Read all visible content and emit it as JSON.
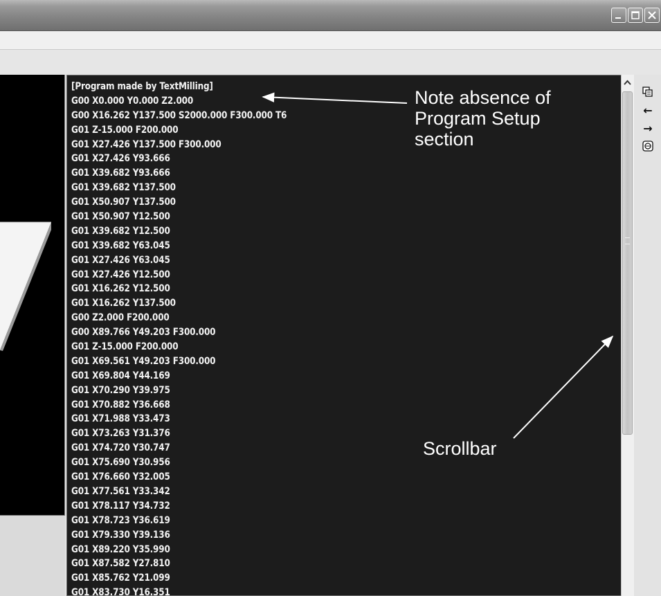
{
  "window": {
    "controls": [
      {
        "name": "minimize-button",
        "icon": "minimize-icon"
      },
      {
        "name": "maximize-button",
        "icon": "maximize-icon"
      },
      {
        "name": "close-button",
        "icon": "close-icon"
      }
    ]
  },
  "code": {
    "lines": [
      "[Program made by TextMilling]",
      "G00 X0.000 Y0.000 Z2.000",
      "G00 X16.262 Y137.500 S2000.000 F300.000 T6",
      "G01 Z-15.000 F200.000",
      "G01 X27.426 Y137.500 F300.000",
      "G01 X27.426 Y93.666",
      "G01 X39.682 Y93.666",
      "G01 X39.682 Y137.500",
      "G01 X50.907 Y137.500",
      "G01 X50.907 Y12.500",
      "G01 X39.682 Y12.500",
      "G01 X39.682 Y63.045",
      "G01 X27.426 Y63.045",
      "G01 X27.426 Y12.500",
      "G01 X16.262 Y12.500",
      "G01 X16.262 Y137.500",
      "G00 Z2.000 F200.000",
      "G00 X89.766 Y49.203 F300.000",
      "G01 Z-15.000 F200.000",
      "G01 X69.561 Y49.203 F300.000",
      "G01 X69.804 Y44.169",
      "G01 X70.290 Y39.975",
      "G01 X70.882 Y36.668",
      "G01 X71.988 Y33.473",
      "G01 X73.263 Y31.376",
      "G01 X74.720 Y30.747",
      "G01 X75.690 Y30.956",
      "G01 X76.660 Y32.005",
      "G01 X77.561 Y33.342",
      "G01 X78.117 Y34.732",
      "G01 X78.723 Y36.619",
      "G01 X79.330 Y39.136",
      "G01 X89.220 Y35.990",
      "G01 X87.582 Y27.810",
      "G01 X85.762 Y21.099",
      "G01 X83.730 Y16.351"
    ]
  },
  "side_tools": [
    {
      "name": "copy-button",
      "icon": "copy-icon"
    },
    {
      "name": "back-button",
      "icon": "arrow-left-icon",
      "glyph": "←"
    },
    {
      "name": "forward-button",
      "icon": "arrow-right-icon",
      "glyph": "→"
    },
    {
      "name": "record-button",
      "icon": "disk-icon"
    }
  ],
  "annotations": {
    "note_lines": [
      "Note absence of",
      "Program Setup",
      "section"
    ],
    "scrollbar_label": "Scrollbar"
  },
  "colors": {
    "code_background": "#1c1c1c",
    "code_text": "#f2f2f2",
    "annotation_text": "#ffffff"
  }
}
